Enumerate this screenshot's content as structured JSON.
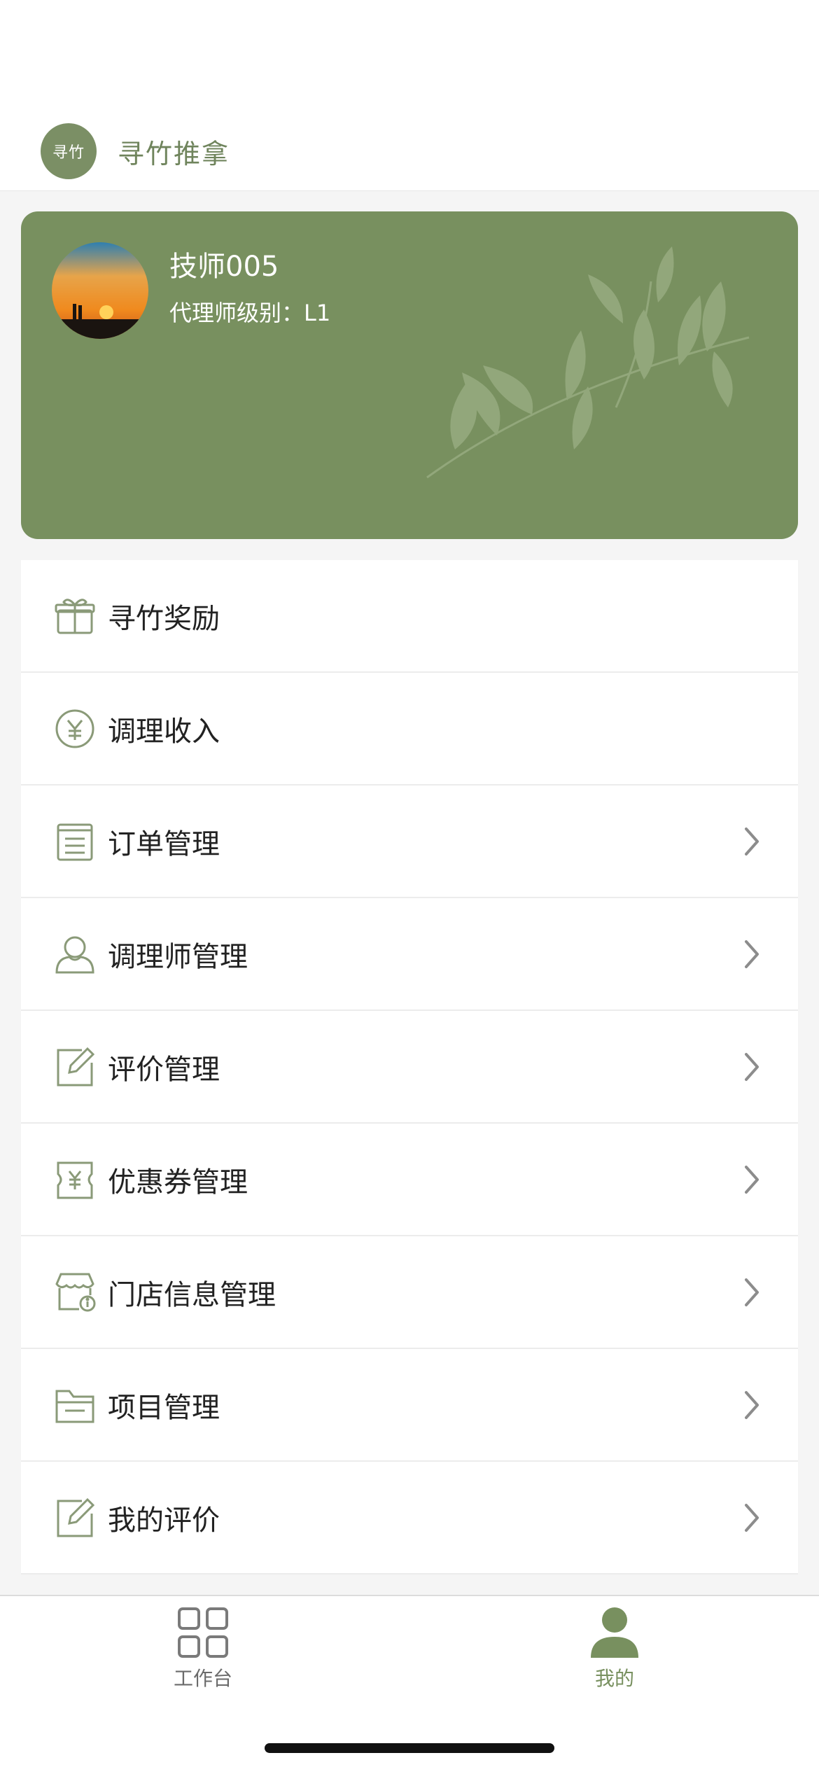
{
  "app": {
    "logo_text": "寻竹",
    "name": "寻竹推拿"
  },
  "profile": {
    "name": "技师005",
    "level": "代理师级别：L1"
  },
  "menu": [
    {
      "label": "寻竹奖励",
      "icon": "gift-icon",
      "has_chevron": false
    },
    {
      "label": "调理收入",
      "icon": "yen-coin-icon",
      "has_chevron": false
    },
    {
      "label": "订单管理",
      "icon": "notepad-icon",
      "has_chevron": true
    },
    {
      "label": "调理师管理",
      "icon": "user-icon",
      "has_chevron": true
    },
    {
      "label": "评价管理",
      "icon": "edit-icon",
      "has_chevron": true
    },
    {
      "label": "优惠券管理",
      "icon": "coupon-icon",
      "has_chevron": true
    },
    {
      "label": "门店信息管理",
      "icon": "store-info-icon",
      "has_chevron": true
    },
    {
      "label": "项目管理",
      "icon": "folder-icon",
      "has_chevron": true
    },
    {
      "label": "我的评价",
      "icon": "edit-icon",
      "has_chevron": true
    }
  ],
  "tabbar": {
    "workbench": {
      "label": "工作台",
      "active": false
    },
    "mine": {
      "label": "我的",
      "active": true
    }
  },
  "colors": {
    "brand": "#78905f",
    "icon": "#8a9a78",
    "chevron": "#8c8c8c"
  }
}
